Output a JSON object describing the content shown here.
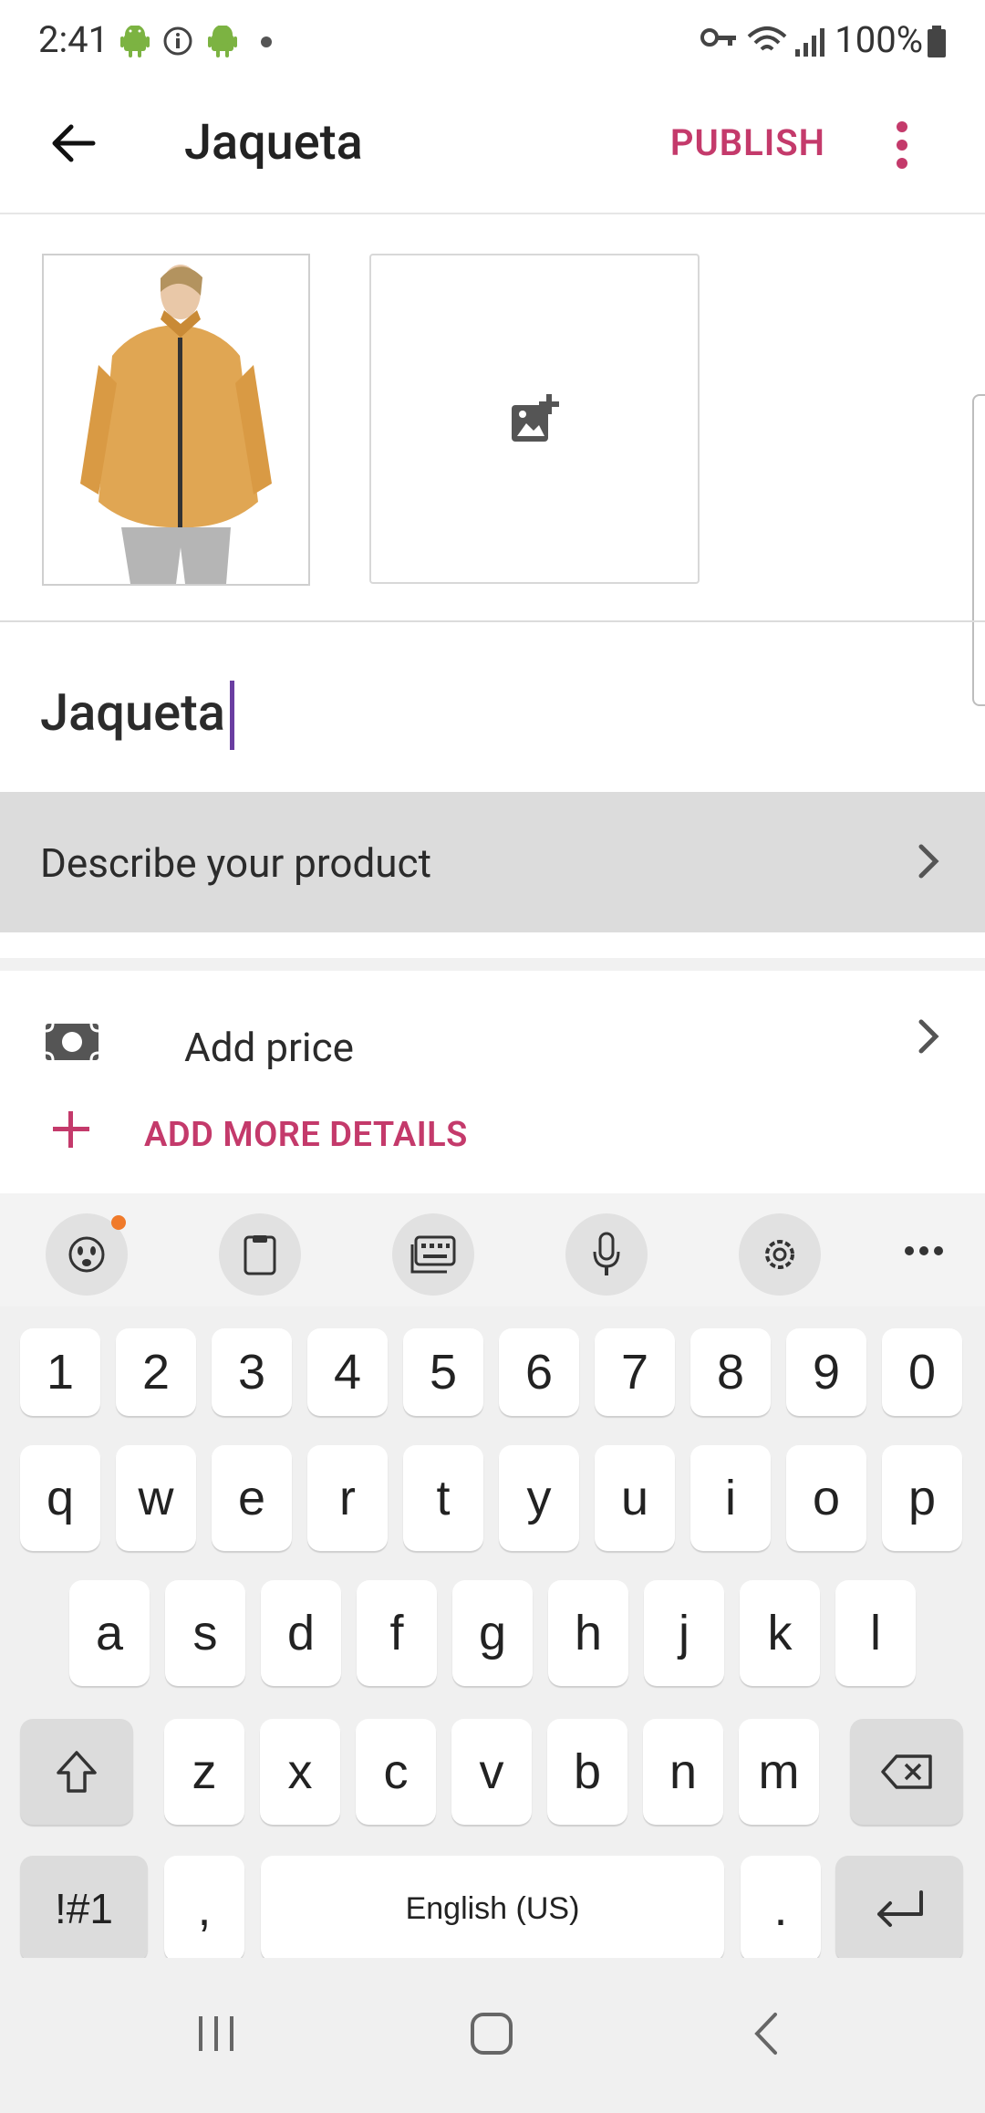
{
  "status_bar": {
    "time": "2:41",
    "battery": "100%"
  },
  "app_bar": {
    "title": "Jaqueta",
    "publish_label": "PUBLISH"
  },
  "product": {
    "name_value": "Jaqueta",
    "describe_label": "Describe your product",
    "price_label": "Add price",
    "add_more_label": "ADD MORE DETAILS"
  },
  "keyboard": {
    "numbers": [
      "1",
      "2",
      "3",
      "4",
      "5",
      "6",
      "7",
      "8",
      "9",
      "0"
    ],
    "row1": [
      "q",
      "w",
      "e",
      "r",
      "t",
      "y",
      "u",
      "i",
      "o",
      "p"
    ],
    "row2": [
      "a",
      "s",
      "d",
      "f",
      "g",
      "h",
      "j",
      "k",
      "l"
    ],
    "row3": [
      "z",
      "x",
      "c",
      "v",
      "b",
      "n",
      "m"
    ],
    "symbols_label": "!#1",
    "comma": ",",
    "space_label": "English (US)",
    "period": "."
  },
  "colors": {
    "accent": "#c43a6b",
    "cursor": "#6a3ea1"
  }
}
